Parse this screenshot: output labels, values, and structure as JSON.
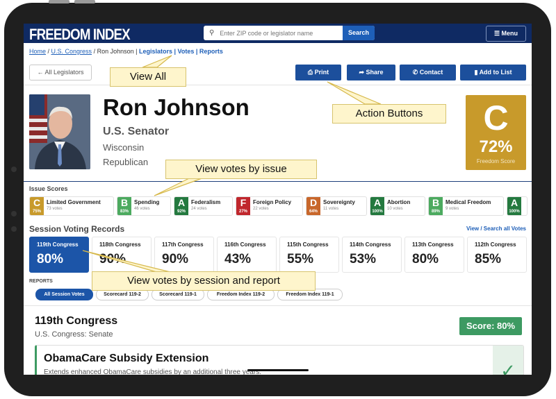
{
  "nav": {
    "logo": "FREEDOM INDEX",
    "search_placeholder": "Enter ZIP code or legislator name",
    "search_button": "Search",
    "menu_label": "Menu"
  },
  "breadcrumb": {
    "home": "Home",
    "congress": "U.S. Congress",
    "current": "Ron Johnson",
    "links": [
      "Legislators",
      "Votes",
      "Reports"
    ]
  },
  "toolbar": {
    "all_legislators": "All Legislators",
    "print": "Print",
    "share": "Share",
    "contact": "Contact",
    "add_to_list": "Add to List"
  },
  "legislator": {
    "name": "Ron Johnson",
    "title": "U.S. Senator",
    "state": "Wisconsin",
    "party": "Republican",
    "grade": "C",
    "percent": "72%",
    "score_label": "Freedom Score"
  },
  "issues": {
    "heading": "Issue Scores",
    "items": [
      {
        "grade": "C",
        "pct": "75%",
        "name": "Limited Government",
        "votes": "73 votes",
        "color": "#c89a2b"
      },
      {
        "grade": "B",
        "pct": "83%",
        "name": "Spending",
        "votes": "46 votes",
        "color": "#4caa5f"
      },
      {
        "grade": "A",
        "pct": "92%",
        "name": "Federalism",
        "votes": "24 votes",
        "color": "#24793f"
      },
      {
        "grade": "F",
        "pct": "27%",
        "name": "Foreign Policy",
        "votes": "22 votes",
        "color": "#c0272d"
      },
      {
        "grade": "D",
        "pct": "64%",
        "name": "Sovereignty",
        "votes": "11 votes",
        "color": "#c8672b"
      },
      {
        "grade": "A",
        "pct": "100%",
        "name": "Abortion",
        "votes": "10 votes",
        "color": "#24793f"
      },
      {
        "grade": "B",
        "pct": "89%",
        "name": "Medical Freedom",
        "votes": "9 votes",
        "color": "#4caa5f"
      },
      {
        "grade": "A",
        "pct": "100%",
        "name": "",
        "votes": "",
        "color": "#24793f"
      }
    ]
  },
  "sessions": {
    "heading": "Session Voting Records",
    "view_all": "View / Search all Votes",
    "items": [
      {
        "label": "119th Congress",
        "pct": "80%"
      },
      {
        "label": "118th Congress",
        "pct": "90%"
      },
      {
        "label": "117th Congress",
        "pct": "90%"
      },
      {
        "label": "116th Congress",
        "pct": "43%"
      },
      {
        "label": "115th Congress",
        "pct": "55%"
      },
      {
        "label": "114th Congress",
        "pct": "53%"
      },
      {
        "label": "113th Congress",
        "pct": "80%"
      },
      {
        "label": "112th Congress",
        "pct": "85%"
      }
    ]
  },
  "reports": {
    "heading": "REPORTS",
    "pills": [
      "All Session Votes",
      "Scorecard 119-2",
      "Scorecard 119-1",
      "Freedom Index 119-2",
      "Freedom Index 119-1"
    ]
  },
  "detail": {
    "congress": "119th Congress",
    "chamber": "U.S. Congress: Senate",
    "score": "Score: 80%",
    "bill_title": "ObamaCare Subsidy Extension",
    "bill_desc": "Extends enhanced ObamaCare subsidies by an additional three years."
  },
  "annotations": {
    "view_all": "View All",
    "action_buttons": "Action Buttons",
    "votes_by_issue": "View votes by issue",
    "votes_by_session": "View votes by session and report"
  }
}
